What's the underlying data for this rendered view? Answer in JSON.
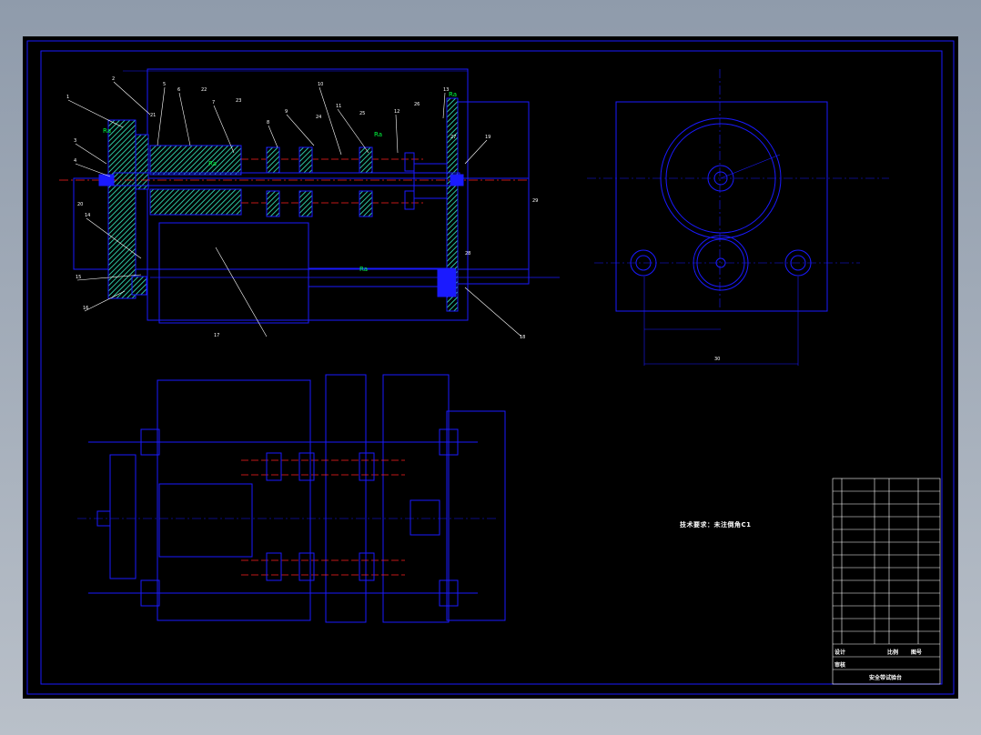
{
  "drawing": {
    "technical_note": "技术要求：未注倒角C1",
    "title_block": {
      "title": "安全带试验台",
      "drawn_label": "设计",
      "check_label": "审核",
      "scale_label": "比例",
      "sheet_label": "图号"
    },
    "part_labels": [
      "1",
      "2",
      "3",
      "4",
      "5",
      "6",
      "7",
      "8",
      "9",
      "10",
      "11",
      "12",
      "13",
      "14",
      "15",
      "16",
      "17",
      "18",
      "19",
      "20",
      "21",
      "22",
      "23",
      "24",
      "25",
      "26",
      "27",
      "28",
      "29",
      "30"
    ],
    "colors": {
      "outline": "#1a1aff",
      "hatch": "#2ec4a0",
      "center": "#ff2020",
      "leader": "#ffffff",
      "dim": "#00ff40"
    }
  }
}
